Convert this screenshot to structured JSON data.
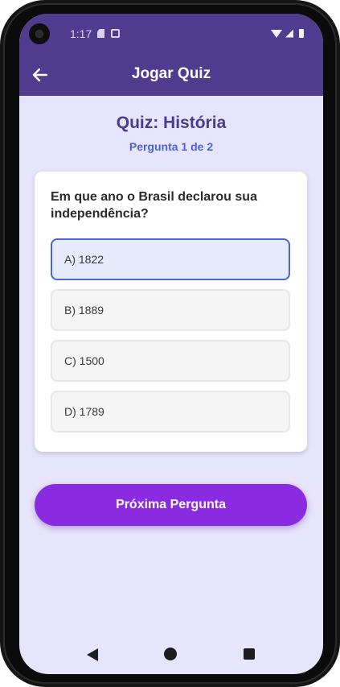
{
  "status_bar": {
    "time": "1:17",
    "icons": [
      "sd-card-icon",
      "screenshot-icon",
      "wifi-icon",
      "signal-icon",
      "battery-icon"
    ]
  },
  "app_bar": {
    "back_icon": "arrow-left-icon",
    "title": "Jogar Quiz"
  },
  "quiz": {
    "title": "Quiz: História",
    "counter": "Pergunta 1 de 2",
    "question": "Em que ano o Brasil declarou sua independência?",
    "options": [
      {
        "label": "A) 1822",
        "selected": true
      },
      {
        "label": "B) 1889",
        "selected": false
      },
      {
        "label": "C) 1500",
        "selected": false
      },
      {
        "label": "D) 1789",
        "selected": false
      }
    ]
  },
  "next_button": {
    "label": "Próxima Pergunta"
  },
  "colors": {
    "app_bar": "#4f3c8f",
    "background": "#e7e5fb",
    "title": "#4b3a8f",
    "counter": "#4a64d4",
    "selected_border": "#4a64d4",
    "selected_fill": "#e5eafc",
    "button": "#8a2be2"
  },
  "nav_bar": {
    "icons": [
      "nav-back-icon",
      "nav-home-icon",
      "nav-recents-icon"
    ]
  }
}
